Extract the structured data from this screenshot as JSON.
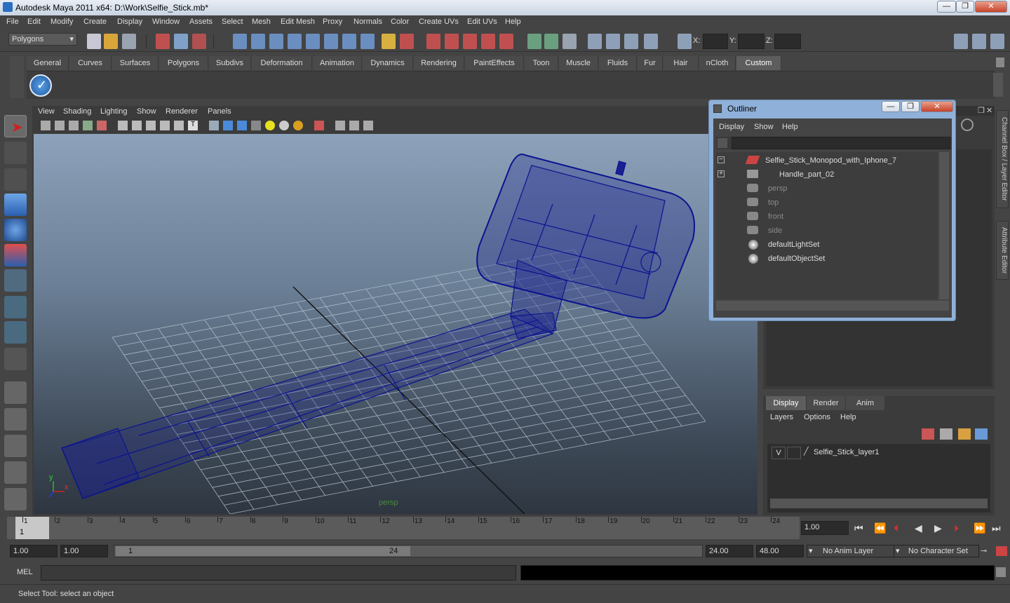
{
  "window": {
    "title": "Autodesk Maya 2011 x64: D:\\Work\\Selfie_Stick.mb*",
    "minimize": "—",
    "restore": "❐",
    "close": "✕"
  },
  "menubar": [
    "File",
    "Edit",
    "Modify",
    "Create",
    "Display",
    "Window",
    "Assets",
    "Select",
    "Mesh",
    "Edit Mesh",
    "Proxy",
    "Normals",
    "Color",
    "Create UVs",
    "Edit UVs",
    "Help"
  ],
  "statusline": {
    "menu_set": "Polygons",
    "x_label": "X:",
    "y_label": "Y:",
    "z_label": "Z:"
  },
  "shelf_tabs": [
    "General",
    "Curves",
    "Surfaces",
    "Polygons",
    "Subdivs",
    "Deformation",
    "Animation",
    "Dynamics",
    "Rendering",
    "PaintEffects",
    "Toon",
    "Muscle",
    "Fluids",
    "Fur",
    "Hair",
    "nCloth",
    "Custom"
  ],
  "shelf_active": "Custom",
  "viewport": {
    "menu": [
      "View",
      "Shading",
      "Lighting",
      "Show",
      "Renderer",
      "Panels"
    ],
    "camera_label": "persp",
    "axis_y": "y",
    "axis_x": "x"
  },
  "outliner": {
    "title": "Outliner",
    "menu": [
      "Display",
      "Show",
      "Help"
    ],
    "items": [
      {
        "label": "Selfie_Stick_Monopod_with_Iphone_7",
        "dim": false
      },
      {
        "label": "Handle_part_02",
        "dim": false
      },
      {
        "label": "persp",
        "dim": true
      },
      {
        "label": "top",
        "dim": true
      },
      {
        "label": "front",
        "dim": true
      },
      {
        "label": "side",
        "dim": true
      },
      {
        "label": "defaultLightSet",
        "dim": false
      },
      {
        "label": "defaultObjectSet",
        "dim": false
      }
    ]
  },
  "side_tabs": [
    "Channel Box / Layer Editor",
    "Attribute Editor"
  ],
  "layer_editor": {
    "tabs": [
      "Display",
      "Render",
      "Anim"
    ],
    "menu": [
      "Layers",
      "Options",
      "Help"
    ],
    "layer_visible": "V",
    "layer_name": "Selfie_Stick_layer1"
  },
  "timeline": {
    "frames": [
      "1",
      "2",
      "3",
      "4",
      "5",
      "6",
      "7",
      "8",
      "9",
      "10",
      "11",
      "12",
      "13",
      "14",
      "15",
      "16",
      "17",
      "18",
      "19",
      "20",
      "21",
      "22",
      "23",
      "24"
    ],
    "current_marker": "1",
    "current_frame": "1.00"
  },
  "range": {
    "start": "1.00",
    "playback_start": "1.00",
    "slider_start": "1",
    "slider_end": "24",
    "playback_end": "24.00",
    "end": "48.00",
    "anim_layer": "No Anim Layer",
    "character_set": "No Character Set"
  },
  "command_line": {
    "label": "MEL"
  },
  "help_line": "Select Tool: select an object"
}
